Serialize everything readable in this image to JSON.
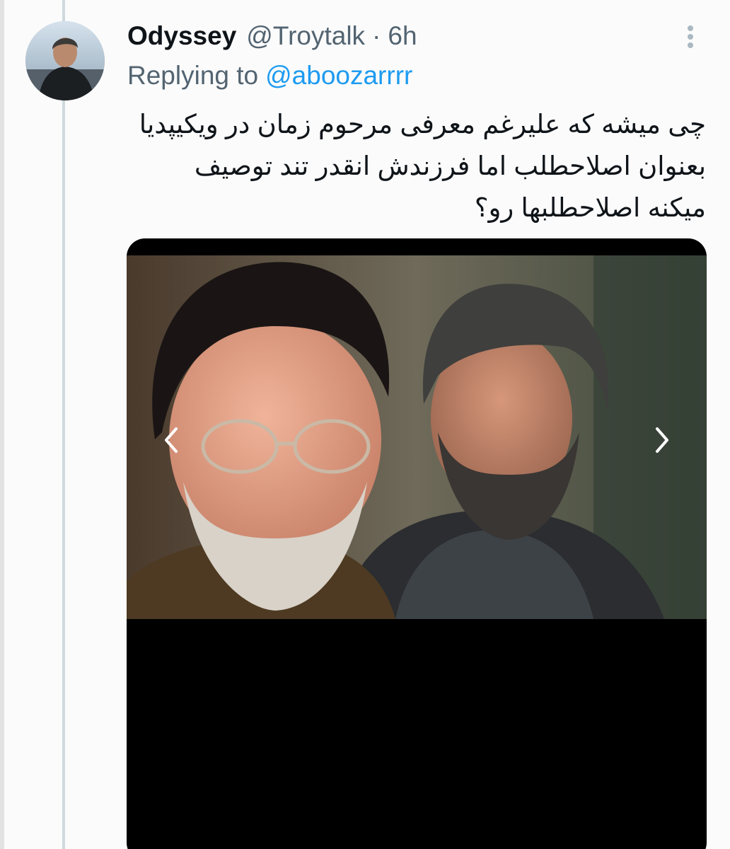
{
  "tweet": {
    "display_name": "Odyssey",
    "handle": "@Troytalk",
    "separator": "·",
    "time": "6h",
    "replying_prefix": "Replying to",
    "replying_handle": "@aboozarrrr",
    "text_lines": [
      "چی میشه که علیرغم معرفی مرحوم زمان در ویکیپدیا",
      "بعنوان اصلاحطلب اما فرزندش انقدر تند توصیف",
      "میکنه اصلاحطلبها رو؟"
    ]
  },
  "icons": {
    "more": "more-vertical-icon",
    "prev": "chevron-left-icon",
    "next": "chevron-right-icon"
  },
  "colors": {
    "primary_text": "#0f1419",
    "secondary_text": "#536471",
    "link": "#1d9bf0",
    "thread_line": "#cfd9de",
    "media_background": "#000000"
  }
}
